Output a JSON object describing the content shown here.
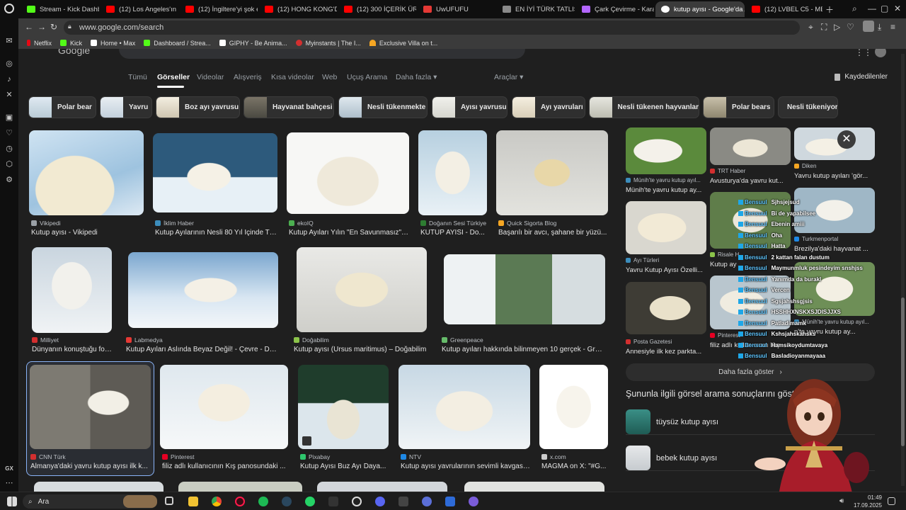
{
  "browser": {
    "tabs": [
      {
        "title": "Stream - Kick Dashbo",
        "color": "#53fc18"
      },
      {
        "title": "(12) Los Angeles'ın K",
        "color": "#ff0000"
      },
      {
        "title": "(12) İngiltere'yi şok e",
        "color": "#ff0000"
      },
      {
        "title": "(12) HONG KONG'DA",
        "color": "#ff0000"
      },
      {
        "title": "(12) 300 İÇERİK ÜRE",
        "color": "#ff0000"
      },
      {
        "title": "UwUFUFU",
        "color": "#e53935"
      },
      {
        "title": "EN İYİ TÜRK TATLISI",
        "color": "#8a8a8a"
      },
      {
        "title": "Çark Çevirme - Kara",
        "color": "#b366ff"
      },
      {
        "title": "kutup ayısı - Google'da A",
        "color": "#ffffff"
      },
      {
        "title": "(12) LVBEL C5 - MEH",
        "color": "#ff0000"
      }
    ],
    "url": "www.google.com/search",
    "bookmarks": [
      {
        "label": "Netflix",
        "color": "#e50914"
      },
      {
        "label": "Kick",
        "color": "#53fc18"
      },
      {
        "label": "Home • Max",
        "color": "#ffffff"
      },
      {
        "label": "Dashboard / Strea...",
        "color": "#53fc18"
      },
      {
        "label": "GIPHY - Be Anima...",
        "color": "#ffffff"
      },
      {
        "label": "Myinstants | The I...",
        "color": "#d32f2f"
      },
      {
        "label": "Exclusive Villa on t...",
        "color": "#f5a623"
      }
    ]
  },
  "search_tabs": [
    {
      "label": "Tümü"
    },
    {
      "label": "Görseller"
    },
    {
      "label": "Videolar"
    },
    {
      "label": "Alışveriş"
    },
    {
      "label": "Kısa videolar"
    },
    {
      "label": "Web"
    },
    {
      "label": "Uçuş Arama"
    },
    {
      "label": "Daha fazla ▾"
    },
    {
      "label": "Araçlar ▾"
    }
  ],
  "saved_label": "Kaydedilenler",
  "chips": [
    {
      "label": "Polar bear"
    },
    {
      "label": "Yavru"
    },
    {
      "label": "Boz ayı yavrusu"
    },
    {
      "label": "Hayvanat bahçesi"
    },
    {
      "label": "Nesli tükenmekte"
    },
    {
      "label": "Ayısı yavrusu"
    },
    {
      "label": "Ayı yavruları"
    },
    {
      "label": "Nesli tükenen hayvanlar"
    },
    {
      "label": "Polar bears"
    },
    {
      "label": "Nesli tükeniyor"
    }
  ],
  "results": [
    {
      "source": "Vikipedi",
      "title": "Kutup ayısı - Vikipedi",
      "fav": "#9aa0a6"
    },
    {
      "source": "İklim Haber",
      "title": "Kutup Ayılarının Nesli 80 Yıl İçinde Tü...",
      "fav": "#3c8dbc"
    },
    {
      "source": "ekoIQ",
      "title": "Kutup Ayıları Yılın \"En Savunmasız\" ...",
      "fav": "#4caf50"
    },
    {
      "source": "Doğanın Sesi Türkiye",
      "title": "KUTUP AYISI - Do...",
      "fav": "#2e7d32"
    },
    {
      "source": "Quick Sigorta Blog",
      "title": "Başarılı bir avcı, şahane bir yüzü...",
      "fav": "#f5a623"
    },
    {
      "source": "Milliyet",
      "title": "Dünyanın konuştuğu fot...",
      "fav": "#d32f2f"
    },
    {
      "source": "Labmedya",
      "title": "Kutup Ayıları Aslında Beyaz Değil! - Çevre - Doğa",
      "fav": "#e53935"
    },
    {
      "source": "Doğabilim",
      "title": "Kutup ayısı (Ursus maritimus) – Doğabilim",
      "fav": "#8bc34a"
    },
    {
      "source": "Greenpeace",
      "title": "Kutup ayıları hakkında bilinmeyen 10 gerçek - Gree...",
      "fav": "#66bb6a"
    },
    {
      "source": "CNN Türk",
      "title": "Almanya'daki yavru kutup ayısı ilk k...",
      "fav": "#d32f2f"
    },
    {
      "source": "Pinterest",
      "title": "filiz adlı kullanıcının Kış panosundaki ...",
      "fav": "#e60023"
    },
    {
      "source": "Pixabay",
      "title": "Kutup Ayısı Buz Ayı Daya...",
      "fav": "#2ec66d"
    },
    {
      "source": "NTV",
      "title": "Kutup ayısı yavrularının sevimli kavgası...",
      "fav": "#1e88e5"
    },
    {
      "source": "x.com",
      "title": "MAGMA on X: \"#G...",
      "fav": "#cccccc"
    }
  ],
  "panel": {
    "cards": [
      {
        "source": "Münih'te yavru kutup ayıl...",
        "title": "Münih'te yavru kutup ay...",
        "fav": "#3c8dbc"
      },
      {
        "source": "TRT Haber",
        "title": "Avusturya'da yavru kut...",
        "fav": "#d32f2f"
      },
      {
        "source": "Diken",
        "title": "Yavru kutup ayıları 'gör...",
        "fav": "#f5a623"
      },
      {
        "source": "Ayı Türleri",
        "title": "Yavru Kutup Ayısı Özelli...",
        "fav": "#3c8dbc"
      },
      {
        "source": "Risale H",
        "title": "Kutup ay",
        "fav": "#8bc34a"
      },
      {
        "source": "Turkmenportal",
        "title": "Brezilya'daki hayvanat ...",
        "fav": "#1e88e5"
      },
      {
        "source": "Posta Gazetesi",
        "title": "Annesiyle ilk kez parkta...",
        "fav": "#d32f2f"
      },
      {
        "source": "Pinterest",
        "title": "filiz adlı kullanıcının Kış",
        "fav": "#e60023"
      },
      {
        "source": "Münih'te yavru kutup ayıl...",
        "title": "n'te yavru kutup ay...",
        "fav": "#3c8dbc"
      }
    ],
    "more_label": "Daha fazla göster",
    "related_title": "Şununla ilgili görsel arama sonuçlarını göster",
    "related": [
      {
        "label": "tüysüz kutup ayısı"
      },
      {
        "label": "bebek kutup ayısı"
      }
    ]
  },
  "chat": [
    {
      "user": "Bensuul",
      "text": "Sjhsjejsud"
    },
    {
      "user": "Bensuul",
      "text": "Bi de yapabilsee"
    },
    {
      "user": "Bensuul",
      "text": "Ebenin amiii"
    },
    {
      "user": "Bensuul",
      "text": "Oha"
    },
    {
      "user": "Bensuul",
      "text": "Hatta"
    },
    {
      "user": "Bensuul",
      "text": "2 kattan falan dustum"
    },
    {
      "user": "Bensuul",
      "text": "Maymunmluk pesindeyim snshjss"
    },
    {
      "user": "Bensuul",
      "text": "Yanımda da burakl"
    },
    {
      "user": "Bensuul",
      "text": "Vercen"
    },
    {
      "user": "Bensuul",
      "text": "Sgsjahshsgjsis"
    },
    {
      "user": "Bensuul",
      "text": "HSSHHXNSKXSJDISJJXS"
    },
    {
      "user": "Bensuul",
      "text": "Patladimamk"
    },
    {
      "user": "Bensuul",
      "text": "Kshsjahskahsks"
    },
    {
      "user": "Bensuul",
      "text": "Hamsikoydumtavaya"
    },
    {
      "user": "Bensuul",
      "text": "Basladioyanmayaaa"
    }
  ],
  "taskbar": {
    "search_label": "Ara",
    "time": "01:49",
    "date": "17.09.2025"
  },
  "sidebar_label": "GX"
}
